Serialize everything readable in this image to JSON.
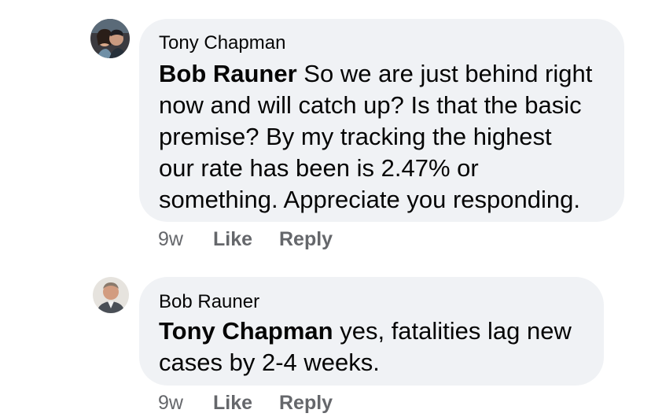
{
  "comments": [
    {
      "author": "Tony Chapman",
      "mention": "Bob Rauner",
      "text_lines": [
        " So we are just behind right",
        "now and will catch up? Is that the basic",
        "premise? By my tracking the highest",
        "our rate has been is 2.47% or",
        "something. Appreciate you responding."
      ],
      "time": "9w",
      "like_label": "Like",
      "reply_label": "Reply",
      "avatar_icon": "couple-photo-avatar"
    },
    {
      "author": "Bob Rauner",
      "mention": "Tony Chapman",
      "text_lines": [
        " yes, fatalities lag new",
        "cases by 2-4 weeks."
      ],
      "time": "9w",
      "like_label": "Like",
      "reply_label": "Reply",
      "avatar_icon": "man-photo-avatar"
    }
  ],
  "colors": {
    "bubble": "#f0f2f5",
    "text": "#050505",
    "meta": "#65676b"
  }
}
